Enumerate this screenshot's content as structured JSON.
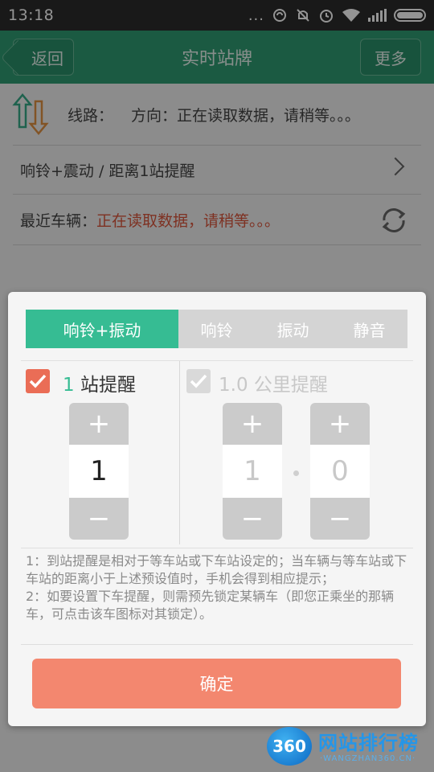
{
  "status_bar": {
    "time": "13:18",
    "more_dots": "..."
  },
  "header": {
    "back_label": "返回",
    "title": "实时站牌",
    "more_label": "更多"
  },
  "route": {
    "label": "线路：",
    "direction": "方向：正在读取数据，请稍等。。。"
  },
  "alert_setting": {
    "text": "响铃+震动 / 距离1站提醒"
  },
  "vehicle": {
    "label": "最近车辆：",
    "status": "正在读取数据，请稍等。。。"
  },
  "dialog": {
    "tabs": [
      {
        "label": "响铃+振动",
        "active": true
      },
      {
        "label": "响铃",
        "active": false
      },
      {
        "label": "振动",
        "active": false
      },
      {
        "label": "静音",
        "active": false
      }
    ],
    "station": {
      "checked": true,
      "count": "1",
      "suffix": " 站提醒",
      "plus": "+",
      "minus": "−",
      "value": "1"
    },
    "distance": {
      "checked": false,
      "label": "1.0 公里提醒",
      "plus": "+",
      "minus": "−",
      "int_value": "1",
      "dec_value": "0"
    },
    "notes": [
      "1：到站提醒是相对于等车站或下车站设定的；当车辆与等车站或下车站的距离小于上述预设值时，手机会得到相应提示；",
      "2：如要设置下车提醒，则需预先锁定某辆车（即您正乘坐的那辆车，可点击该车图标对其锁定）。"
    ],
    "confirm_label": "确定"
  },
  "watermark": {
    "badge": "360",
    "text": "网站排行榜",
    "sub": "·WANGZHAN360.CN·"
  },
  "colors": {
    "header_green": "#2f9c73",
    "tab_active": "#36bc93",
    "accent_orange": "#ea6d56",
    "confirm": "#f3876f",
    "status_red": "#d9553b"
  }
}
